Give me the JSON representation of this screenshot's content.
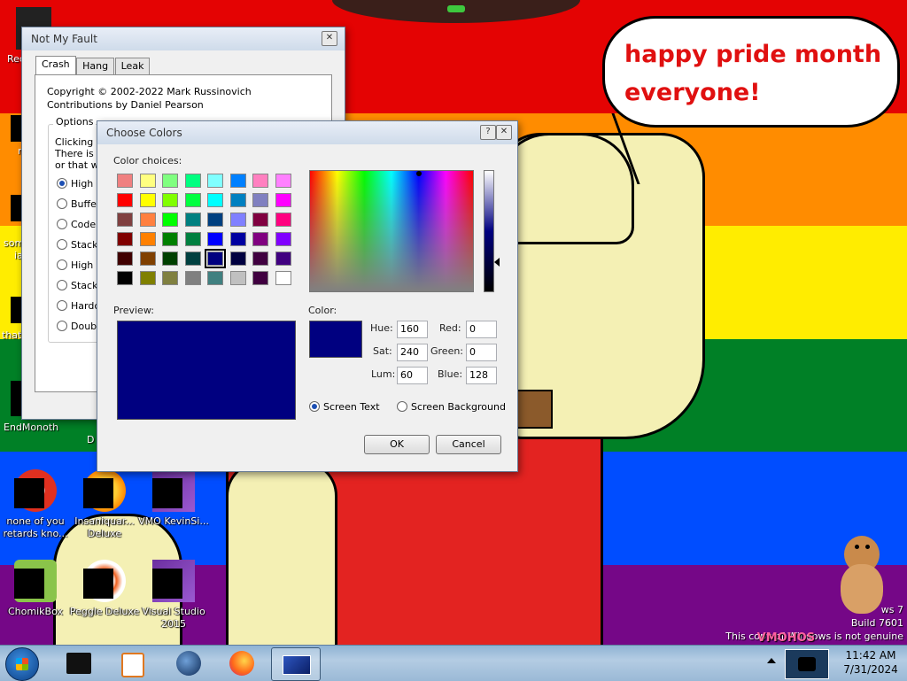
{
  "desktop": {
    "speech_bubble": {
      "line1": "happy pride month",
      "line2": "everyone!"
    },
    "icons": [
      {
        "label": "none of you retards kno..."
      },
      {
        "label": "Insaniquar... Deluxe"
      },
      {
        "label": "VMO KevinSi..."
      },
      {
        "label": "ChomikBox"
      },
      {
        "label": "Peggle Deluxe"
      },
      {
        "label": "Visual Studio 2015"
      }
    ],
    "edge_labels": {
      "rec": "Rec",
      "some": "som",
      "some2": "ia",
      "that": "that",
      "endm": "EndMonoth",
      "d1": "D",
      "r": "r"
    },
    "watermark": {
      "version": "ws 7",
      "build": "Build 7601",
      "genuine": "This copy of Windows is not genuine",
      "logo": "VMOHOS"
    },
    "colors": {
      "red": "#e40303",
      "orange": "#ff8c00",
      "yellow": "#ffed00",
      "green": "#008026",
      "blue": "#004dff",
      "purple": "#750787"
    }
  },
  "not_my_fault": {
    "title": "Not My Fault",
    "close": "✕",
    "tabs": [
      "Crash",
      "Hang",
      "Leak"
    ],
    "copyright": "Copyright © 2002-2022 Mark Russinovich",
    "contributions": "Contributions by Daniel Pearson",
    "options_label": "Options",
    "desc1": "Clicking th",
    "desc2": "There is a",
    "desc3": "or that w",
    "options": [
      "High I",
      "Buffer",
      "Code",
      "Stack",
      "High I",
      "Stack",
      "Hardco",
      "Double"
    ]
  },
  "choose_colors": {
    "title": "Choose Colors",
    "help": "?",
    "close": "✕",
    "color_choices_label": "Color choices:",
    "swatches": [
      "#f08080",
      "#ffff80",
      "#80ff80",
      "#00ff80",
      "#80ffff",
      "#0080ff",
      "#ff80c0",
      "#ff80ff",
      "#ff0000",
      "#ffff00",
      "#80ff00",
      "#00ff40",
      "#00ffff",
      "#0080c0",
      "#8080c0",
      "#ff00ff",
      "#804040",
      "#ff8040",
      "#00ff00",
      "#008080",
      "#004080",
      "#8080ff",
      "#800040",
      "#ff0080",
      "#800000",
      "#ff8000",
      "#008000",
      "#008040",
      "#0000ff",
      "#0000a0",
      "#800080",
      "#8000ff",
      "#400000",
      "#804000",
      "#004000",
      "#004040",
      "#000080",
      "#000040",
      "#400040",
      "#400080",
      "#000000",
      "#808000",
      "#808040",
      "#808080",
      "#408080",
      "#c0c0c0",
      "#400040",
      "#ffffff"
    ],
    "selected_swatch_index": 36,
    "preview_label": "Preview:",
    "color_label": "Color:",
    "current_color": "#000080",
    "hue_label": "Hue:",
    "hue": "160",
    "sat_label": "Sat:",
    "sat": "240",
    "lum_label": "Lum:",
    "lum": "60",
    "red_label": "Red:",
    "red": "0",
    "green_label": "Green:",
    "green": "0",
    "blue_label": "Blue:",
    "blue": "128",
    "screen_text": "Screen Text",
    "screen_background": "Screen Background",
    "ok": "OK",
    "cancel": "Cancel"
  },
  "taskbar": {
    "time": "11:42 AM",
    "date": "7/31/2024"
  }
}
